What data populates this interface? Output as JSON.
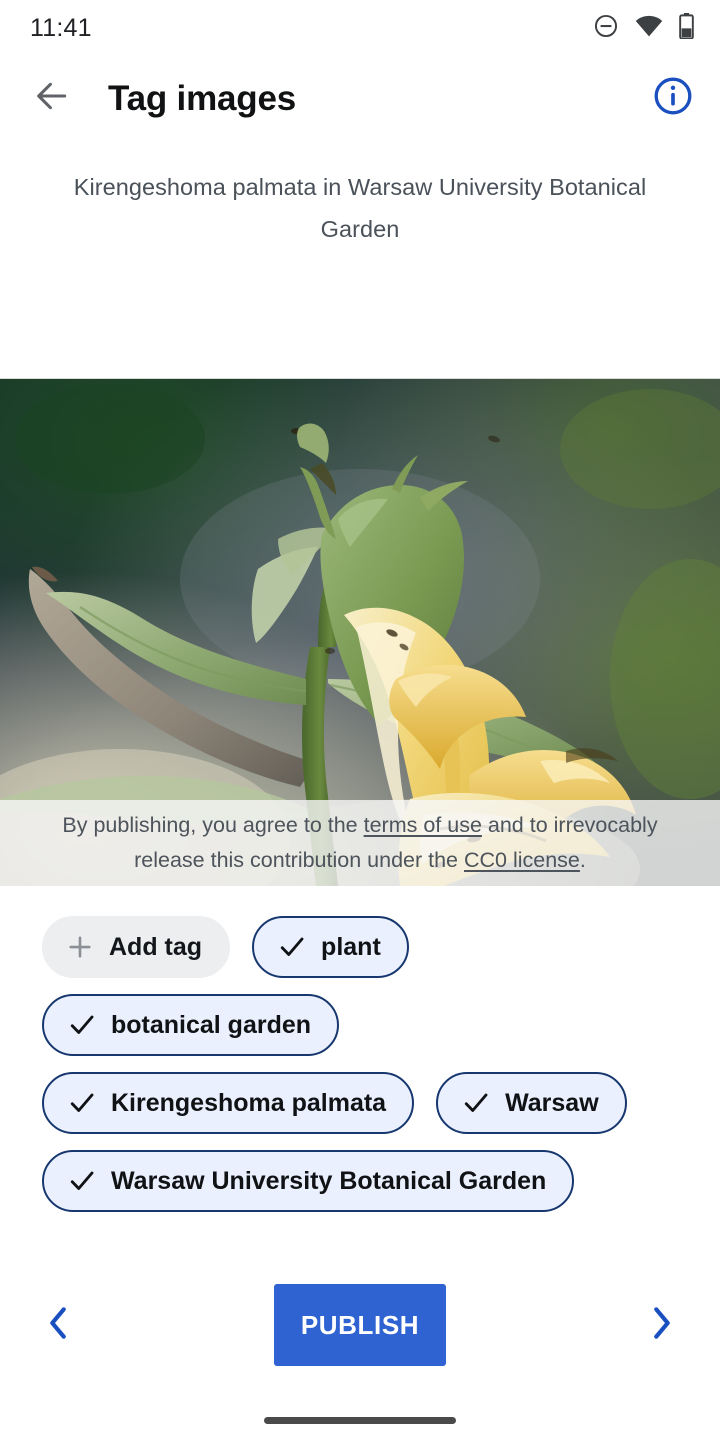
{
  "status_bar": {
    "time": "11:41",
    "icons": [
      "do-not-disturb-icon",
      "wifi-icon",
      "battery-icon"
    ]
  },
  "app_bar": {
    "back_icon": "back-arrow-icon",
    "title": "Tag images",
    "info_icon": "info-icon"
  },
  "caption": {
    "text": "Kirengeshoma palmata in Warsaw University Botanical Garden"
  },
  "photo": {
    "alt": "Kirengeshoma palmata yellow flower close-up",
    "license_notice": {
      "prefix": "By publishing, you agree to the ",
      "link1": "terms of use",
      "middle": " and to irrevocably release this contribution under the ",
      "link2": "CC0 license",
      "suffix": "."
    }
  },
  "tags": {
    "add_tag": {
      "label": "Add tag",
      "icon": "plus-icon",
      "selected": false
    },
    "items": [
      {
        "label": "plant",
        "icon": "check-icon",
        "selected": true
      },
      {
        "label": "botanical garden",
        "icon": "check-icon",
        "selected": true
      },
      {
        "label": "Kirengeshoma palmata",
        "icon": "check-icon",
        "selected": true
      },
      {
        "label": "Warsaw",
        "icon": "check-icon",
        "selected": true
      },
      {
        "label": "Warsaw University Botanical Garden",
        "icon": "check-icon",
        "selected": true
      }
    ]
  },
  "footer": {
    "prev_icon": "chevron-left-icon",
    "publish_label": "PUBLISH",
    "next_icon": "chevron-right-icon"
  },
  "colors": {
    "accent_blue": "#1a4fc0",
    "publish_blue": "#2f63d2",
    "chip_selected_bg": "#eaf0fd",
    "chip_selected_border": "#17376f",
    "chip_add_bg": "#eceef0",
    "caption_gray": "#4a5159"
  }
}
